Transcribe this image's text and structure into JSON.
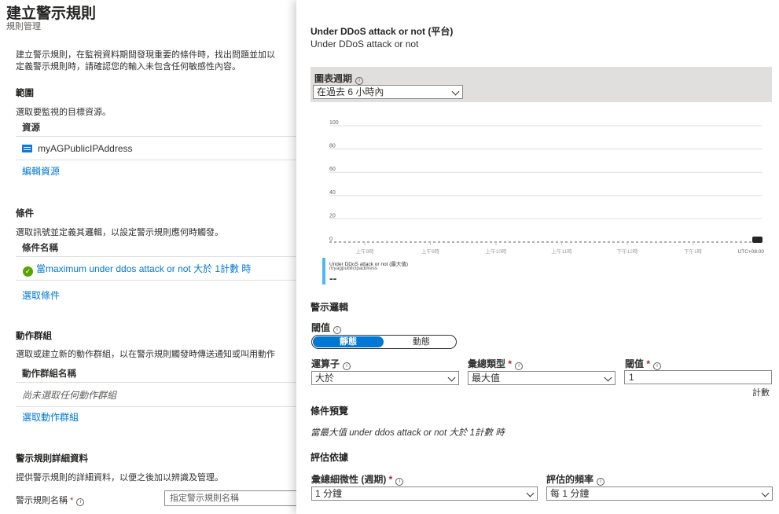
{
  "blade": {
    "title": "建立警示規則",
    "subtitle": "規則管理",
    "intro_line1": "建立警示規則，在監視資料期間發現重要的條件時，找出問題並加以",
    "intro_line2": "定義警示規則時，請確認您的輸入未包含任何敏感性內容。",
    "scope": {
      "heading": "範圍",
      "desc": "選取要監視的目標資源。",
      "column": "資源",
      "resource_name": "myAGPublicIPAddress",
      "edit_link": "編輯資源"
    },
    "condition": {
      "heading": "條件",
      "desc": "選取訊號並定義其邏輯，以設定警示規則應何時觸發。",
      "column": "條件名稱",
      "row_text": "當maximum under ddos attack or not 大於 1計數 時",
      "select_link": "選取條件"
    },
    "action_group": {
      "heading": "動作群組",
      "desc": "選取或建立新的動作群組，以在警示規則觸發時傳送通知或叫用動作",
      "column": "動作群組名稱",
      "empty_row": "尚未選取任何動作群組",
      "select_link": "選取動作群組"
    },
    "details": {
      "heading": "警示規則詳細資料",
      "desc": "提供警示規則的詳細資料，以便之後加以辨識及管理。",
      "name_label": "警示規則名稱",
      "required_mark": "*",
      "name_placeholder": "指定警示規則名稱"
    }
  },
  "panel": {
    "signal_title": "Under DDoS attack or not (平台)",
    "signal_subtitle": "Under DDoS attack or not",
    "chart_period_label": "圖表週期",
    "chart_period_value": "在過去 6 小時內",
    "alert_logic_heading": "警示邏輯",
    "threshold_label": "閾值",
    "threshold_static": "靜態",
    "threshold_dynamic": "動態",
    "operator_label": "運算子",
    "operator_value": "大於",
    "aggregation_label": "彙總類型",
    "aggregation_value": "最大值",
    "threshold_value_label": "閾值",
    "threshold_value": "1",
    "required_mark": "*",
    "unit": "計數",
    "preview_heading": "條件預覽",
    "preview_text": "當最大值 under ddos attack or not 大於 1計數 時",
    "evaluate_heading": "評估依據",
    "granularity_label": "彙總細微性 (週期)",
    "granularity_value": "1 分鐘",
    "frequency_label": "評估的頻率",
    "frequency_value": "每 1 分鐘"
  },
  "chart_data": {
    "type": "line",
    "y_ticks": [
      "100",
      "80",
      "60",
      "40",
      "20",
      "0"
    ],
    "ylim": [
      0,
      100
    ],
    "x_ticks": [
      "上午8時",
      "上午9時",
      "上午10時",
      "上午11時",
      "下午12時",
      "下午1時"
    ],
    "timezone": "UTC+08:00",
    "series": [
      {
        "name": "Under DDoS attack or not (最大值)",
        "values": [
          0,
          0,
          0,
          0,
          0,
          0
        ]
      }
    ],
    "legend": {
      "name": "Under DDoS attack or not (最大值)",
      "resource": "myagpublicipaddress",
      "value": "--"
    },
    "colors": {
      "series": "#4fb8f0",
      "grid": "#e1dfdd",
      "line": "#605e5c"
    }
  }
}
